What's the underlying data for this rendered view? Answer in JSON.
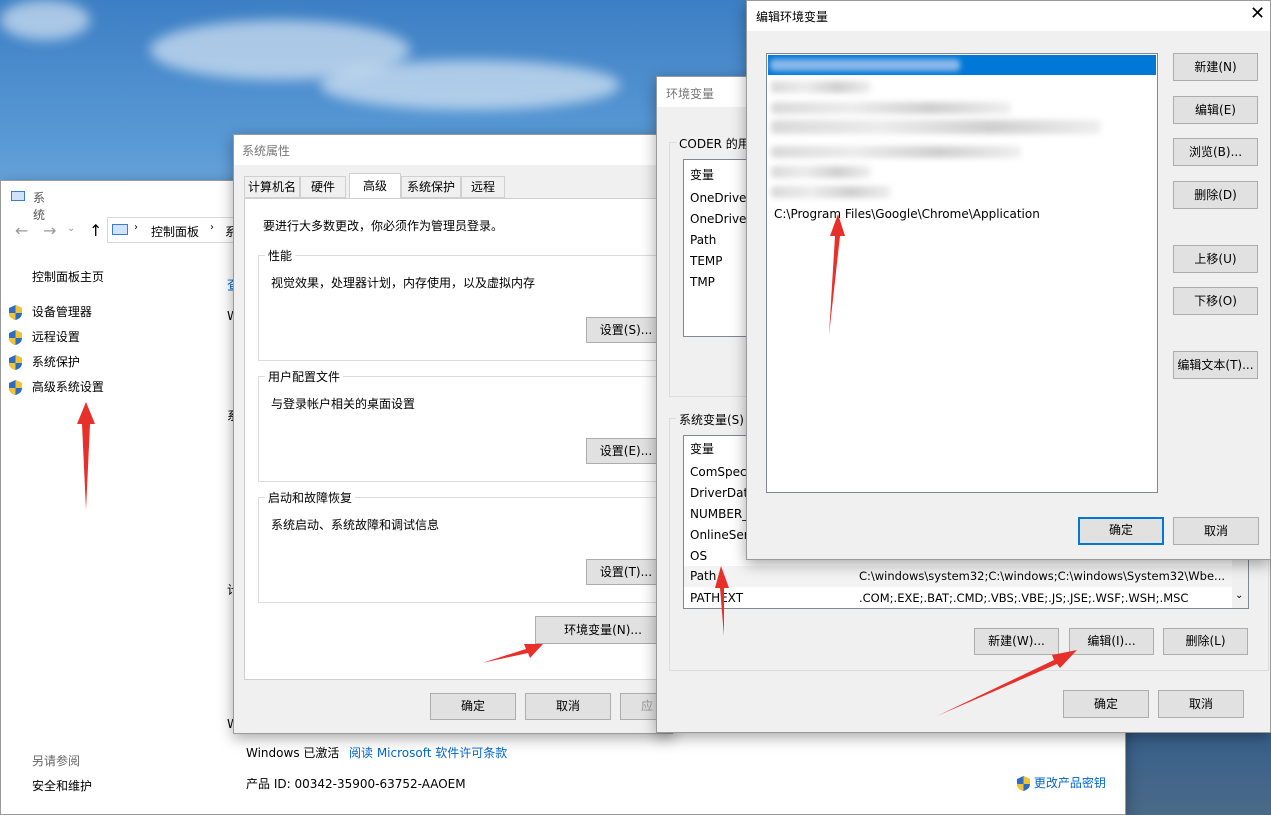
{
  "system_window": {
    "title": "系统",
    "breadcrumb": [
      "控制面板",
      "系"
    ],
    "home_link": "控制面板主页",
    "links": [
      "设备管理器",
      "远程设置",
      "系统保护",
      "高级系统设置"
    ],
    "see_also": "另请参阅",
    "security": "安全和维护",
    "partial_labels": [
      "查",
      "W",
      "系",
      "计",
      "W"
    ],
    "windows_activated": "Windows 已激活",
    "license_link": "阅读 Microsoft 软件许可条款",
    "product_id": "产品 ID: 00342-35900-63752-AAOEM",
    "change_key": "更改产品密钥"
  },
  "sys_props": {
    "title": "系统属性",
    "tabs": [
      "计算机名",
      "硬件",
      "高级",
      "系统保护",
      "远程"
    ],
    "admin_note": "要进行大多数更改，你必须作为管理员登录。",
    "perf_legend": "性能",
    "perf_desc": "视觉效果，处理器计划，内存使用，以及虚拟内存",
    "perf_btn": "设置(S)...",
    "profile_legend": "用户配置文件",
    "profile_desc": "与登录帐户相关的桌面设置",
    "profile_btn": "设置(E)...",
    "startup_legend": "启动和故障恢复",
    "startup_desc": "系统启动、系统故障和调试信息",
    "startup_btn": "设置(T)...",
    "env_btn": "环境变量(N)...",
    "ok": "确定",
    "cancel": "取消",
    "apply": "应"
  },
  "env_vars": {
    "title": "环境变量",
    "user_legend": "CODER 的用",
    "user_header": "变量",
    "user_rows": [
      "OneDrive",
      "OneDriveC",
      "Path",
      "TEMP",
      "TMP"
    ],
    "sys_legend": "系统变量(S)",
    "sys_header": "变量",
    "sys_rows": [
      {
        "name": "ComSpec",
        "value": ""
      },
      {
        "name": "DriverData",
        "value": ""
      },
      {
        "name": "NUMBER_",
        "value": ""
      },
      {
        "name": "OnlineSer",
        "value": ""
      },
      {
        "name": "OS",
        "value": ""
      },
      {
        "name": "Path",
        "value": "C:\\windows\\system32;C:\\windows;C:\\windows\\System32\\Wbe..."
      },
      {
        "name": "PATHEXT",
        "value": ".COM;.EXE;.BAT;.CMD;.VBS;.VBE;.JS;.JSE;.WSF;.WSH;.MSC"
      }
    ],
    "new_btn": "新建(W)...",
    "edit_btn": "编辑(I)...",
    "delete_btn": "删除(L)",
    "ok": "确定",
    "cancel": "取消"
  },
  "edit_env": {
    "title": "编辑环境变量",
    "visible_entry": "C:\\Program Files\\Google\\Chrome\\Application",
    "buttons": [
      "新建(N)",
      "编辑(E)",
      "浏览(B)...",
      "删除(D)",
      "上移(U)",
      "下移(O)",
      "编辑文本(T)..."
    ],
    "ok": "确定",
    "cancel": "取消"
  },
  "colors": {
    "accent": "#0078d7",
    "link": "#0066cc",
    "annotation_arrow": "#e8302a"
  }
}
